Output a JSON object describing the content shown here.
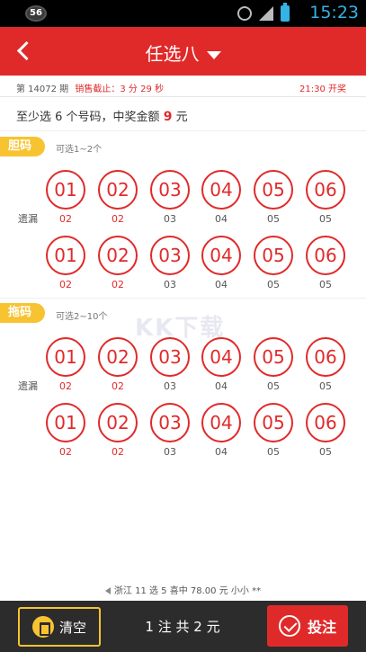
{
  "status_bar": {
    "badge": "56",
    "time": "15:23"
  },
  "header": {
    "title": "任选八"
  },
  "info": {
    "issue": "第 14072 期",
    "deadline": "销售截止：3 分 29 秒",
    "draw_time": "21:30 开奖"
  },
  "tip": {
    "prefix": "至少选 6 个号码，中奖金额",
    "amount": "9",
    "suffix": "元"
  },
  "sections": [
    {
      "tag": "胆码",
      "hint": "可选1~2个",
      "row_label": "遗漏",
      "rows": [
        [
          {
            "n": "01",
            "m": "02",
            "hot": true
          },
          {
            "n": "02",
            "m": "02",
            "hot": true
          },
          {
            "n": "03",
            "m": "03",
            "hot": false
          },
          {
            "n": "04",
            "m": "04",
            "hot": false
          },
          {
            "n": "05",
            "m": "05",
            "hot": false
          },
          {
            "n": "06",
            "m": "05",
            "hot": false
          }
        ],
        [
          {
            "n": "01",
            "m": "02",
            "hot": true
          },
          {
            "n": "02",
            "m": "02",
            "hot": true
          },
          {
            "n": "03",
            "m": "03",
            "hot": false
          },
          {
            "n": "04",
            "m": "04",
            "hot": false
          },
          {
            "n": "05",
            "m": "05",
            "hot": false
          },
          {
            "n": "06",
            "m": "05",
            "hot": false
          }
        ]
      ]
    },
    {
      "tag": "拖码",
      "hint": "可选2~10个",
      "row_label": "遗漏",
      "rows": [
        [
          {
            "n": "01",
            "m": "02",
            "hot": true
          },
          {
            "n": "02",
            "m": "02",
            "hot": true
          },
          {
            "n": "03",
            "m": "03",
            "hot": false
          },
          {
            "n": "04",
            "m": "04",
            "hot": false
          },
          {
            "n": "05",
            "m": "05",
            "hot": false
          },
          {
            "n": "06",
            "m": "05",
            "hot": false
          }
        ],
        [
          {
            "n": "01",
            "m": "02",
            "hot": true
          },
          {
            "n": "02",
            "m": "02",
            "hot": true
          },
          {
            "n": "03",
            "m": "03",
            "hot": false
          },
          {
            "n": "04",
            "m": "04",
            "hot": false
          },
          {
            "n": "05",
            "m": "05",
            "hot": false
          },
          {
            "n": "06",
            "m": "05",
            "hot": false
          }
        ]
      ]
    }
  ],
  "watermark": "KK下载",
  "prize_line": "浙江 11 选 5 喜中 78.00 元 小小 **",
  "footer": {
    "clear_label": "清空",
    "summary": "1 注 共 2 元",
    "bet_label": "投注"
  },
  "colors": {
    "primary": "#e02a2a",
    "accent": "#f7c331",
    "footer_bg": "#2c2c2c"
  }
}
